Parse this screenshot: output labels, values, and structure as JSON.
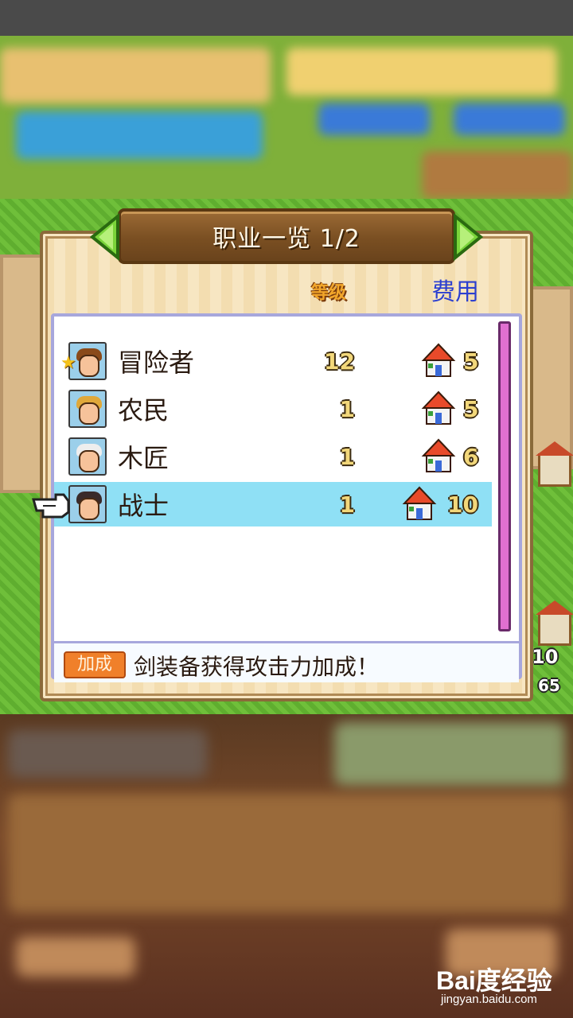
{
  "dialog": {
    "title": "职业一览 1/2",
    "header_level": "等级",
    "header_cost": "费用",
    "jobs": [
      {
        "name": "冒险者",
        "level": "12",
        "cost": "5",
        "starred": true,
        "selected": false
      },
      {
        "name": "农民",
        "level": "1",
        "cost": "5",
        "starred": false,
        "selected": false
      },
      {
        "name": "木匠",
        "level": "1",
        "cost": "6",
        "starred": false,
        "selected": false
      },
      {
        "name": "战士",
        "level": "1",
        "cost": "10",
        "starred": false,
        "selected": true
      }
    ],
    "bonus_badge": "加成",
    "bonus_text": "剑装备获得攻击力加成！"
  },
  "field": {
    "side_value_1": "10",
    "side_value_2": "65"
  },
  "watermark": {
    "logo": "Bai度经验",
    "url": "jingyan.baidu.com"
  },
  "colors": {
    "selected_row": "#8fe0f5",
    "header_cost": "#2b3fd0",
    "header_level": "#f2a62a",
    "scrollbar": "#e070d0",
    "badge": "#f0802a"
  }
}
